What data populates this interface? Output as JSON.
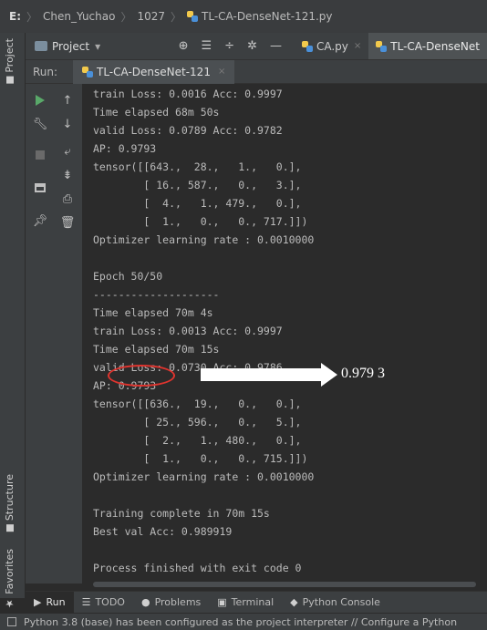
{
  "breadcrumb": {
    "drive": "E:",
    "folder1": "Chen_Yuchao",
    "folder2": "1027",
    "file": "TL-CA-DenseNet-121.py"
  },
  "left_strip": {
    "project": "Project",
    "structure": "Structure",
    "favorites": "Favorites"
  },
  "toolbar": {
    "project_label": "Project",
    "dropdown_icon": "▾",
    "tabs": [
      {
        "label": "CA.py",
        "close": "×"
      },
      {
        "label": "TL-CA-DenseNet",
        "close": "×"
      }
    ]
  },
  "run": {
    "label": "Run:",
    "tab": "TL-CA-DenseNet-121",
    "close": "×"
  },
  "console": {
    "lines": [
      "train Loss: 0.0016 Acc: 0.9997",
      "Time elapsed 68m 50s",
      "valid Loss: 0.0789 Acc: 0.9782",
      "AP: 0.9793",
      "tensor([[643.,  28.,   1.,   0.],",
      "        [ 16., 587.,   0.,   3.],",
      "        [  4.,   1., 479.,   0.],",
      "        [  1.,   0.,   0., 717.]])",
      "Optimizer learning rate : 0.0010000",
      "",
      "Epoch 50/50",
      "--------------------",
      "Time elapsed 70m 4s",
      "train Loss: 0.0013 Acc: 0.9997",
      "Time elapsed 70m 15s",
      "valid Loss: 0.0730 Acc: 0.9786",
      "AP: 0.9793",
      "tensor([[636.,  19.,   0.,   0.],",
      "        [ 25., 596.,   0.,   5.],",
      "        [  2.,   1., 480.,   0.],",
      "        [  1.,   0.,   0., 715.]])",
      "Optimizer learning rate : 0.0010000",
      "",
      "Training complete in 70m 15s",
      "Best val Acc: 0.989919",
      "",
      "Process finished with exit code 0"
    ]
  },
  "annotation": {
    "value": "0.979 3"
  },
  "bottom_tools": {
    "run": "Run",
    "todo": "TODO",
    "problems": "Problems",
    "terminal": "Terminal",
    "python_console": "Python Console"
  },
  "status": {
    "message": "Python 3.8 (base) has been configured as the project interpreter // Configure a Python"
  },
  "colors": {
    "console_bg": "#2b2b2b",
    "panel_bg": "#3c3f41",
    "run_green": "#59a869",
    "annotation_red": "#e0342e"
  }
}
